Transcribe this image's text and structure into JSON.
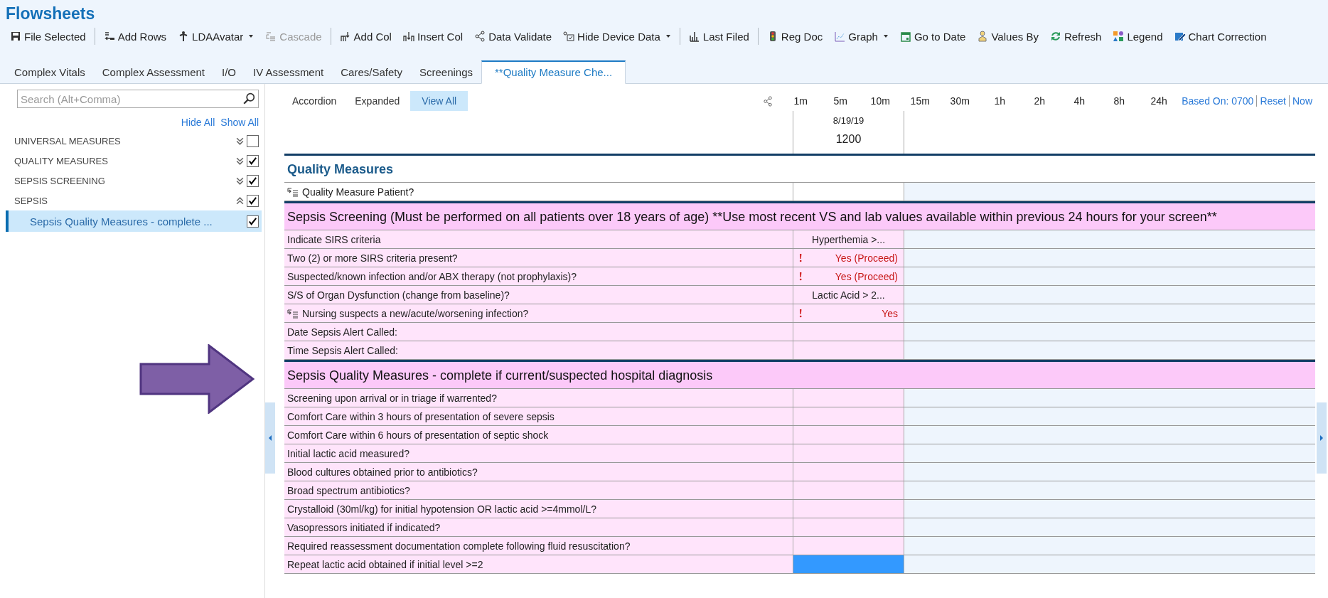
{
  "app_title": "Flowsheets",
  "toolbar": [
    {
      "kind": "button",
      "label": "File Selected",
      "dropdown": false,
      "disabled": false
    },
    {
      "kind": "separator"
    },
    {
      "kind": "button",
      "label": "Add Rows",
      "dropdown": false,
      "disabled": false
    },
    {
      "kind": "button",
      "label": "LDAAvatar",
      "dropdown": true,
      "disabled": false
    },
    {
      "kind": "button",
      "label": "Cascade",
      "dropdown": false,
      "disabled": true
    },
    {
      "kind": "separator"
    },
    {
      "kind": "button",
      "label": "Add Col",
      "dropdown": false,
      "disabled": false
    },
    {
      "kind": "button",
      "label": "Insert Col",
      "dropdown": false,
      "disabled": false
    },
    {
      "kind": "button",
      "label": "Data Validate",
      "dropdown": false,
      "disabled": false
    },
    {
      "kind": "button",
      "label": "Hide Device Data",
      "dropdown": true,
      "disabled": false
    },
    {
      "kind": "separator"
    },
    {
      "kind": "button",
      "label": "Last Filed",
      "dropdown": false,
      "disabled": false
    },
    {
      "kind": "separator"
    },
    {
      "kind": "button",
      "label": "Reg Doc",
      "dropdown": false,
      "disabled": false
    },
    {
      "kind": "button",
      "label": "Graph",
      "dropdown": true,
      "disabled": false
    },
    {
      "kind": "button",
      "label": "Go to Date",
      "dropdown": false,
      "disabled": false
    },
    {
      "kind": "button",
      "label": "Values By",
      "dropdown": false,
      "disabled": false
    },
    {
      "kind": "button",
      "label": "Refresh",
      "dropdown": false,
      "disabled": false
    },
    {
      "kind": "button",
      "label": "Legend",
      "dropdown": false,
      "disabled": false
    },
    {
      "kind": "button",
      "label": "Chart Correction",
      "dropdown": false,
      "disabled": false
    }
  ],
  "tabs": [
    {
      "label": "Complex Vitals",
      "selected": false
    },
    {
      "label": "Complex Assessment",
      "selected": false
    },
    {
      "label": "I/O",
      "selected": false
    },
    {
      "label": "IV Assessment",
      "selected": false
    },
    {
      "label": "Cares/Safety",
      "selected": false
    },
    {
      "label": "Screenings",
      "selected": false
    },
    {
      "label": "**Quality Measure Che...",
      "selected": true
    }
  ],
  "sidebar": {
    "search": {
      "placeholder": "Search (Alt+Comma)"
    },
    "links": [
      "Hide All",
      "Show All"
    ],
    "groups": [
      {
        "label": "UNIVERSAL MEASURES",
        "expanded": false,
        "checked": false
      },
      {
        "label": "QUALITY MEASURES",
        "expanded": false,
        "checked": true
      },
      {
        "label": "SEPSIS SCREENING",
        "expanded": false,
        "checked": true
      },
      {
        "label": "SEPSIS",
        "expanded": true,
        "checked": true,
        "children": [
          {
            "label": "Sepsis Quality Measures - complete ...",
            "selected": true,
            "checked": true
          }
        ]
      }
    ]
  },
  "view_modes": [
    {
      "label": "Accordion",
      "selected": false
    },
    {
      "label": "Expanded",
      "selected": false
    },
    {
      "label": "View All",
      "selected": true
    }
  ],
  "intervals": [
    "1m",
    "5m",
    "10m",
    "15m",
    "30m",
    "1h",
    "2h",
    "4h",
    "8h",
    "24h"
  ],
  "time_links": [
    "Based On: 0700",
    "Reset",
    "Now"
  ],
  "column": {
    "date": "8/19/19",
    "time": "1200"
  },
  "sections": [
    {
      "title": "Quality Measures",
      "kind": "plain",
      "rows": [
        {
          "label": "Quality Measure Patient?",
          "icon": true,
          "alert": false,
          "selected": false
        }
      ]
    },
    {
      "title": "Sepsis Screening (Must be performed on all patients over 18 years of age) **Use most recent VS and lab values available within previous 24 hours for your screen**",
      "kind": "highlight",
      "rows": [
        {
          "label": "Indicate SIRS criteria",
          "icon": false,
          "value": "Hyperthemia >...",
          "alert": false,
          "selected": false
        },
        {
          "label": "Two (2) or more SIRS criteria present?",
          "icon": false,
          "value": "Yes (Proceed)",
          "alert": true,
          "selected": false
        },
        {
          "label": "Suspected/known infection and/or ABX therapy (not prophylaxis)?",
          "icon": false,
          "value": "Yes (Proceed)",
          "alert": true,
          "selected": false
        },
        {
          "label": "S/S of Organ Dysfunction (change from baseline)?",
          "icon": false,
          "value": "Lactic Acid > 2...",
          "alert": false,
          "selected": false
        },
        {
          "label": "Nursing suspects a new/acute/worsening infection?",
          "icon": true,
          "value": "Yes",
          "alert": true,
          "selected": false
        },
        {
          "label": "Date Sepsis Alert Called:",
          "icon": false,
          "alert": false,
          "selected": false
        },
        {
          "label": "Time Sepsis Alert Called:",
          "icon": false,
          "alert": false,
          "selected": false
        }
      ]
    },
    {
      "title": "Sepsis Quality Measures - complete if current/suspected hospital diagnosis",
      "kind": "highlight",
      "rows": [
        {
          "label": "Screening upon arrival or in triage if warrented?",
          "icon": false,
          "alert": false,
          "selected": false
        },
        {
          "label": "Comfort Care within 3 hours of presentation of severe sepsis",
          "icon": false,
          "alert": false,
          "selected": false
        },
        {
          "label": "Comfort Care within 6 hours of presentation of septic shock",
          "icon": false,
          "alert": false,
          "selected": false
        },
        {
          "label": "Initial lactic acid measured?",
          "icon": false,
          "alert": false,
          "selected": false
        },
        {
          "label": "Blood cultures obtained prior to antibiotics?",
          "icon": false,
          "alert": false,
          "selected": false
        },
        {
          "label": "Broad spectrum antibiotics?",
          "icon": false,
          "alert": false,
          "selected": false
        },
        {
          "label": "Crystalloid (30ml/kg) for initial hypotension OR lactic acid >=4mmol/L?",
          "icon": false,
          "alert": false,
          "selected": false
        },
        {
          "label": "Vasopressors initiated if indicated?",
          "icon": false,
          "alert": false,
          "selected": false
        },
        {
          "label": "Required reassessment documentation complete following fluid resuscitation?",
          "icon": false,
          "alert": false,
          "selected": false
        },
        {
          "label": "Repeat lactic acid obtained if initial level >=2",
          "icon": false,
          "alert": false,
          "selected": true
        }
      ]
    }
  ]
}
